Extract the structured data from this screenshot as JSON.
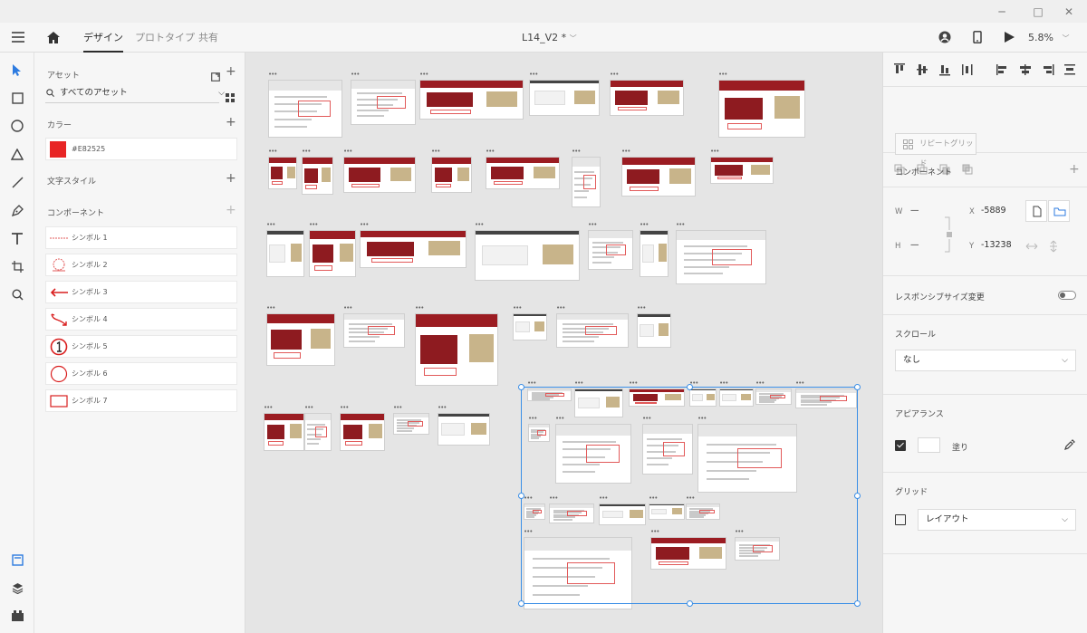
{
  "window": {
    "minimize": "─",
    "maximize": "□",
    "close": "✕"
  },
  "topbar": {
    "tabs": [
      {
        "label": "デザイン"
      },
      {
        "label": "プロトタイプ"
      },
      {
        "label": "共有"
      }
    ],
    "doc_title": "L14_V2 *",
    "zoom": "5.8%"
  },
  "assets": {
    "title": "アセット",
    "search_label": "すべてのアセット",
    "colors_header": "カラー",
    "color_hex": "#E82525",
    "text_styles_header": "文字スタイル",
    "components_header": "コンポーネント",
    "symbols": [
      {
        "label": "シンボル 1"
      },
      {
        "label": "シンボル 2"
      },
      {
        "label": "シンボル 3"
      },
      {
        "label": "シンボル 4"
      },
      {
        "label": "シンボル 5"
      },
      {
        "label": "シンボル 6"
      },
      {
        "label": "シンボル 7"
      }
    ],
    "colors": {
      "accent": "#e82525"
    }
  },
  "props": {
    "repeat_grid": "リピートグリッド",
    "component_header": "コンポーネント",
    "w_label": "W",
    "w_value": "—",
    "h_label": "H",
    "h_value": "—",
    "x_label": "X",
    "x_value": "-5889",
    "y_label": "Y",
    "y_value": "-13238",
    "responsive_resize": "レスポンシブサイズ変更",
    "scroll_header": "スクロール",
    "scroll_value": "なし",
    "appearance_header": "アピアランス",
    "fill_label": "塗り",
    "grid_header": "グリッド",
    "grid_value": "レイアウト"
  }
}
